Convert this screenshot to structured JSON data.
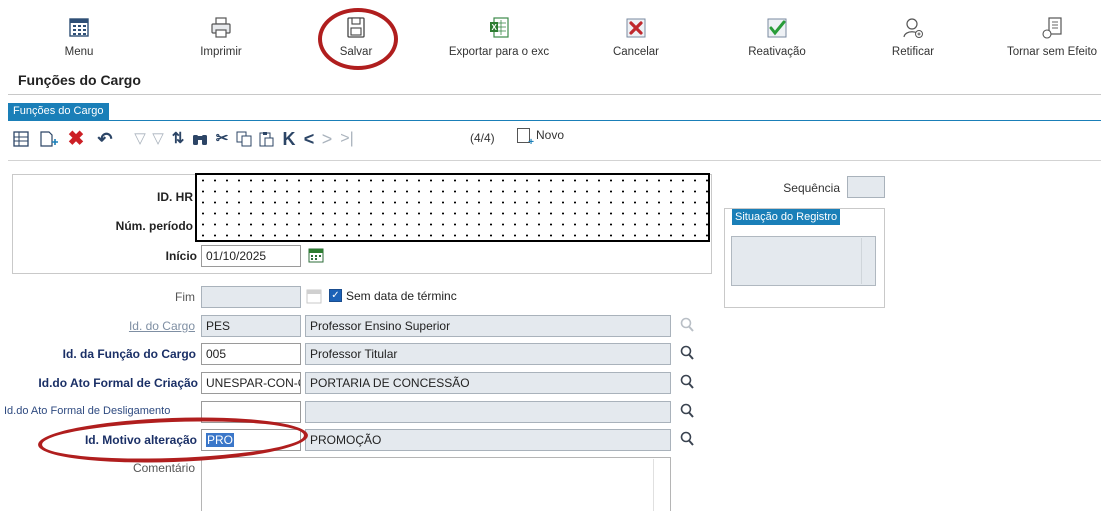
{
  "toolbar": {
    "menu": "Menu",
    "imprimir": "Imprimir",
    "salvar": "Salvar",
    "exportar": "Exportar para o exc",
    "cancelar": "Cancelar",
    "reativacao": "Reativação",
    "retificar": "Retificar",
    "tornar_sem_efeito": "Tornar sem Efeito"
  },
  "page_title": "Funções do Cargo",
  "tab_label": "Funções do Cargo",
  "grid_toolbar": {
    "record_counter": "(4/4)",
    "novo_label": "Novo"
  },
  "header": {
    "id_hr_label": "ID. HR",
    "num_periodo_label": "Núm. período",
    "inicio_label": "Início",
    "inicio_value": "01/10/2025"
  },
  "form": {
    "fim_label": "Fim",
    "fim_value": "",
    "sem_data_label": "Sem data de términc",
    "sem_data_checked": true,
    "id_cargo_label": "Id. do Cargo",
    "id_cargo_code": "PES",
    "id_cargo_desc": "Professor Ensino Superior",
    "id_funcao_label": "Id. da Função do Cargo",
    "id_funcao_code": "005",
    "id_funcao_desc": "Professor Titular",
    "ato_criacao_label": "Id.do Ato Formal de Criação",
    "ato_criacao_code": "UNESPAR-CON-C",
    "ato_criacao_desc": "PORTARIA DE CONCESSÃO",
    "ato_deslig_label": "Id.do Ato Formal de Desligamento",
    "ato_deslig_code": "",
    "ato_deslig_desc": "",
    "motivo_label": "Id. Motivo alteração",
    "motivo_code": "PRO",
    "motivo_desc": "PROMOÇÃO",
    "comentario_label": "Comentário",
    "comentario_value": ""
  },
  "right_panel": {
    "sequencia_label": "Sequência",
    "sequencia_value": "",
    "situacao_label": "Situação do Registro",
    "situacao_value": ""
  },
  "colors": {
    "accent_blue": "#1a7fb8",
    "annotation_red": "#b01e1e",
    "readonly_bg": "#e4e9ee",
    "label_navy": "#1a2f66"
  }
}
